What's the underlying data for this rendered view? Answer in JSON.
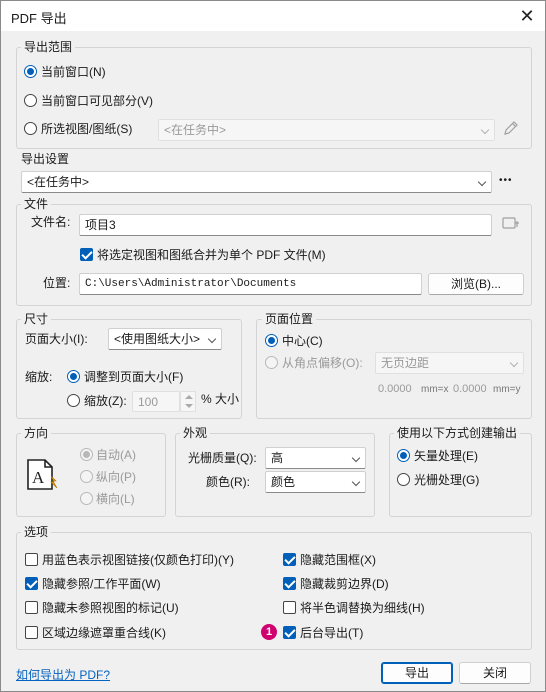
{
  "window": {
    "title": "PDF 导出"
  },
  "export_range": {
    "group_label": "导出范围",
    "options": [
      "当前窗口(N)",
      "当前窗口可见部分(V)",
      "所选视图/图纸(S)"
    ],
    "selected_index": 0,
    "views_select": "<在任务中>"
  },
  "export_settings": {
    "group_label": "导出设置",
    "preset": "<在任务中>",
    "more": "•••"
  },
  "file": {
    "group_label": "文件",
    "name_label": "文件名:",
    "name_value": "项目3",
    "combine_label": "将选定视图和图纸合并为单个 PDF 文件(M)",
    "combine_checked": true,
    "location_label": "位置:",
    "location_value": "C:\\Users\\Administrator\\Documents",
    "browse_label": "浏览(B)..."
  },
  "size": {
    "group_label": "尺寸",
    "page_size_label": "页面大小(I):",
    "page_size_value": "<使用图纸大小>",
    "zoom_label": "缩放:",
    "fit_label": "调整到页面大小(F)",
    "zoom_option_label": "缩放(Z):",
    "zoom_value": "100",
    "percent_label": "% 大小"
  },
  "page_position": {
    "group_label": "页面位置",
    "center_label": "中心(C)",
    "offset_label": "从角点偏移(O):",
    "offset_select": "无页边距",
    "x_value": "0.0000",
    "x_unit": "mm=x",
    "y_value": "0.0000",
    "y_unit": "mm=y"
  },
  "orientation": {
    "group_label": "方向",
    "options": [
      "自动(A)",
      "纵向(P)",
      "横向(L)"
    ],
    "selected_index": 0
  },
  "appearance": {
    "group_label": "外观",
    "raster_quality_label": "光栅质量(Q):",
    "raster_quality_value": "高",
    "color_label": "颜色(R):",
    "color_value": "颜色"
  },
  "output_method": {
    "group_label": "使用以下方式创建输出",
    "options": [
      "矢量处理(E)",
      "光栅处理(G)"
    ],
    "selected_index": 0
  },
  "options": {
    "group_label": "选项",
    "items": [
      {
        "label": "用蓝色表示视图链接(仅颜色打印)(Y)",
        "checked": false
      },
      {
        "label": "隐藏范围框(X)",
        "checked": true
      },
      {
        "label": "隐藏参照/工作平面(W)",
        "checked": true
      },
      {
        "label": "隐藏裁剪边界(D)",
        "checked": true
      },
      {
        "label": "隐藏未参照视图的标记(U)",
        "checked": false
      },
      {
        "label": "将半色调替换为细线(H)",
        "checked": false
      },
      {
        "label": "区域边缘遮罩重合线(K)",
        "checked": false
      },
      {
        "label": "后台导出(T)",
        "checked": true
      }
    ],
    "badge": "1"
  },
  "footer": {
    "help_link": "如何导出为 PDF?",
    "export_button": "导出",
    "close_button": "关闭"
  },
  "colors": {
    "accent": "#005fb8",
    "badge": "#d0006f",
    "link": "#0563c1"
  }
}
